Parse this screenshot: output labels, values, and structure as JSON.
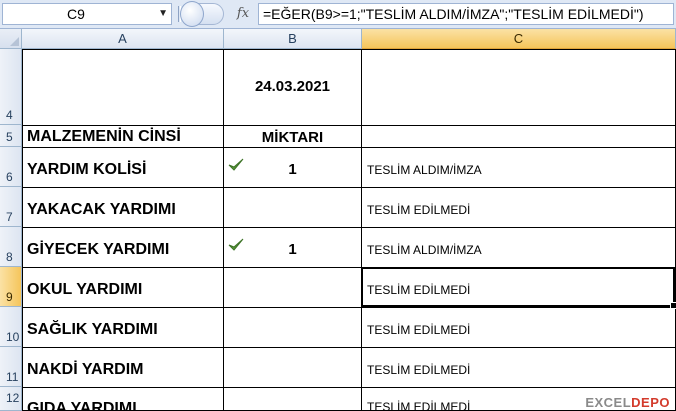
{
  "formula_bar": {
    "name_box": "C9",
    "fx_label": "fx",
    "formula": "=EĞER(B9>=1;\"TESLİM ALDIM/İMZA\";\"TESLİM EDİLMEDİ\")"
  },
  "columns": [
    "A",
    "B",
    "C"
  ],
  "selected_cell": "C9",
  "rows": [
    {
      "num": "4",
      "a": "",
      "b": "24.03.2021",
      "c": "",
      "check": false
    },
    {
      "num": "5",
      "a": "MALZEMENİN CİNSİ",
      "b": "MİKTARI",
      "c": "",
      "check": false
    },
    {
      "num": "6",
      "a": "YARDIM KOLİSİ",
      "b": "1",
      "c": "TESLİM ALDIM/İMZA",
      "check": true
    },
    {
      "num": "7",
      "a": "YAKACAK YARDIMI",
      "b": "",
      "c": "TESLİM EDİLMEDİ",
      "check": false
    },
    {
      "num": "8",
      "a": "GİYECEK YARDIMI",
      "b": "1",
      "c": "TESLİM ALDIM/İMZA",
      "check": true
    },
    {
      "num": "9",
      "a": "OKUL YARDIMI",
      "b": "",
      "c": "TESLİM EDİLMEDİ",
      "check": false
    },
    {
      "num": "10",
      "a": "SAĞLIK YARDIMI",
      "b": "",
      "c": "TESLİM EDİLMEDİ",
      "check": false
    },
    {
      "num": "11",
      "a": "NAKDİ YARDIM",
      "b": "",
      "c": "TESLİM EDİLMEDİ",
      "check": false
    },
    {
      "num": "12",
      "a": "GIDA YARDIMI",
      "b": "",
      "c": "TESLİM EDİLMEDİ",
      "check": false
    }
  ],
  "watermark": {
    "part1": "EXCEL",
    "part2": "DEPO"
  },
  "colors": {
    "check": "#5a9a3c",
    "header_selected": "#f5c55b"
  }
}
